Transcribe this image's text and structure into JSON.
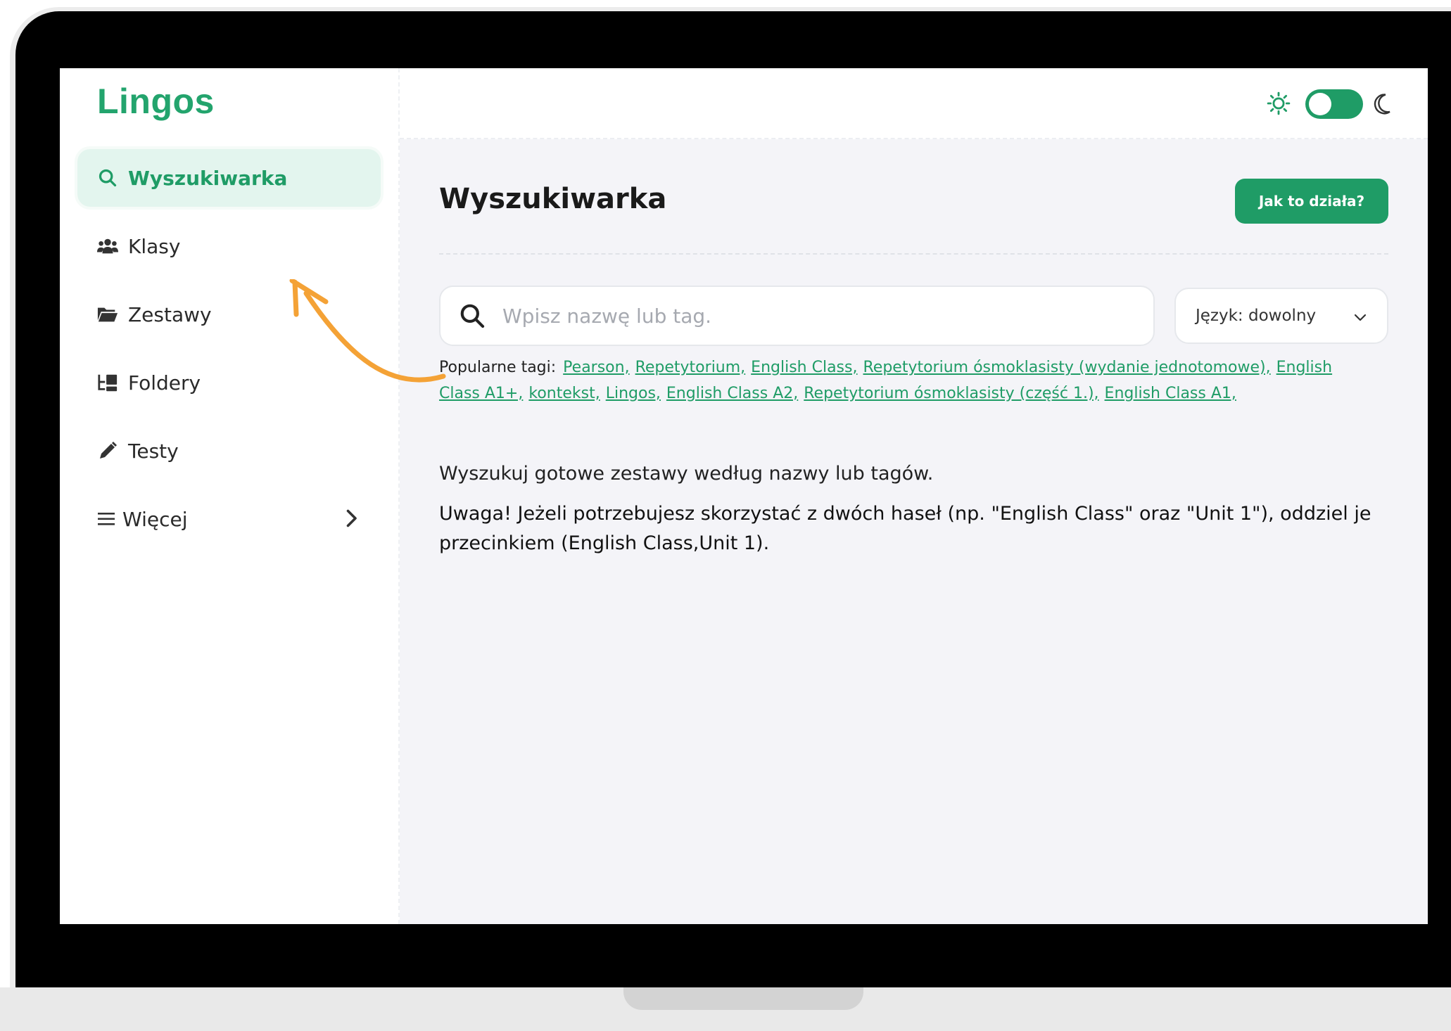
{
  "app": {
    "logo": "Lingos"
  },
  "sidebar": {
    "items": [
      {
        "label": "Wyszukiwarka",
        "icon": "search-icon",
        "active": true
      },
      {
        "label": "Klasy",
        "icon": "users-icon"
      },
      {
        "label": "Zestawy",
        "icon": "folder-open-icon"
      },
      {
        "label": "Foldery",
        "icon": "folder-tree-icon"
      },
      {
        "label": "Testy",
        "icon": "pencil-icon"
      },
      {
        "label": "Więcej",
        "icon": "menu-icon",
        "has_submenu": true
      }
    ]
  },
  "topbar": {
    "theme": "dark-mode-toggle"
  },
  "main": {
    "title": "Wyszukiwarka",
    "help_button": "Jak to działa?",
    "search": {
      "placeholder": "Wpisz nazwę lub tag.",
      "value": ""
    },
    "language_select": {
      "value": "Język: dowolny"
    },
    "popular_label": "Popularne tagi:",
    "tags": [
      "Pearson,",
      "Repetytorium,",
      "English Class,",
      "Repetytorium ósmoklasisty (wydanie jednotomowe),",
      "English Class A1+,",
      "kontekst,",
      "Lingos,",
      "English Class A2,",
      "Repetytorium ósmoklasisty (część 1.),",
      "English Class A1,"
    ],
    "description": "Wyszukuj gotowe zestawy według nazwy lub tagów.",
    "note": "Uwaga! Jeżeli potrzebujesz skorzystać z dwóch haseł (np. \"English Class\" oraz \"Unit 1\"), oddziel je przecinkiem (English Class,Unit 1)."
  },
  "colors": {
    "accent": "#1f9c66",
    "accent_light": "#e3f5ee",
    "annotation": "#f4a236",
    "background": "#f4f4f8"
  }
}
